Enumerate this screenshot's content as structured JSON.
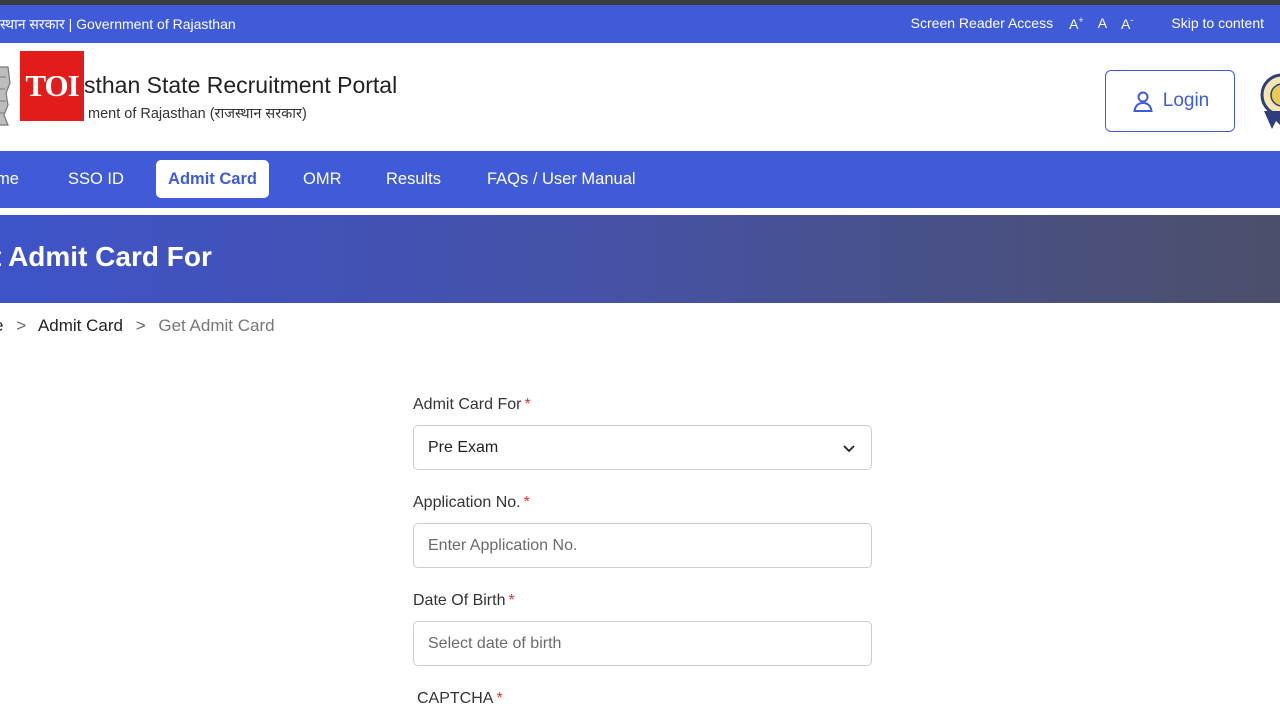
{
  "topbar": {
    "gov_text": "स्थान सरकार | Government of Rajasthan",
    "screen_reader": "Screen Reader Access",
    "font_increase": "A",
    "font_normal": "A",
    "font_decrease": "A",
    "skip": "Skip to content"
  },
  "header": {
    "logo_text": "TOI",
    "title": "sthan State Recruitment Portal",
    "subtitle": "ment of Rajasthan (राजस्थान सरकार)",
    "login_label": "Login"
  },
  "nav": {
    "items": [
      "me",
      "SSO ID",
      "Admit Card",
      "OMR",
      "Results",
      "FAQs / User Manual"
    ],
    "active_index": 2
  },
  "banner": {
    "title": "t Admit Card For"
  },
  "breadcrumb": {
    "home": "e",
    "parent": "Admit Card",
    "current": "Get Admit Card",
    "separator": ">"
  },
  "form": {
    "admit_card_for": {
      "label": "Admit Card For",
      "value": "Pre Exam"
    },
    "application_no": {
      "label": "Application No.",
      "placeholder": "Enter Application No."
    },
    "dob": {
      "label": "Date Of Birth",
      "placeholder": "Select date of birth"
    },
    "captcha": {
      "label": "CAPTCHA"
    },
    "required_mark": "*"
  },
  "colors": {
    "brand_blue": "#3f5bd8",
    "logo_red": "#e21b1b",
    "required_red": "#e03131"
  }
}
